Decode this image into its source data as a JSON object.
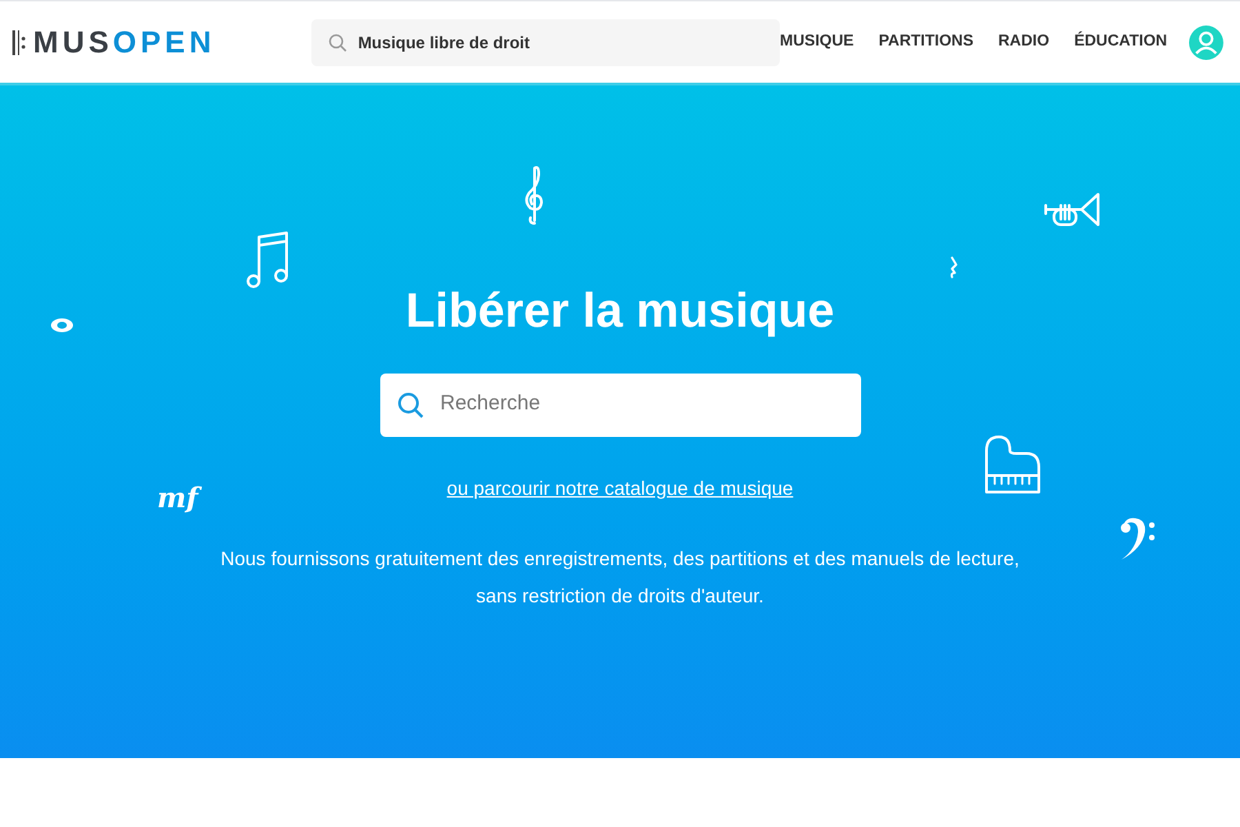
{
  "header": {
    "logo": {
      "dark": "MUS",
      "accent": "OPEN"
    },
    "search": {
      "value": "Musique libre de droit"
    },
    "nav": [
      "MUSIQUE",
      "PARTITIONS",
      "RADIO",
      "ÉDUCATION"
    ]
  },
  "hero": {
    "title": "Libérer la musique",
    "search": {
      "placeholder": "Recherche"
    },
    "link": "ou parcourir notre catalogue de musique",
    "dynamic": "mf",
    "description": [
      "Nous fournissons gratuitement des enregistrements, des partitions et des manuels de lecture,",
      "sans restriction de droits d'auteur."
    ]
  }
}
